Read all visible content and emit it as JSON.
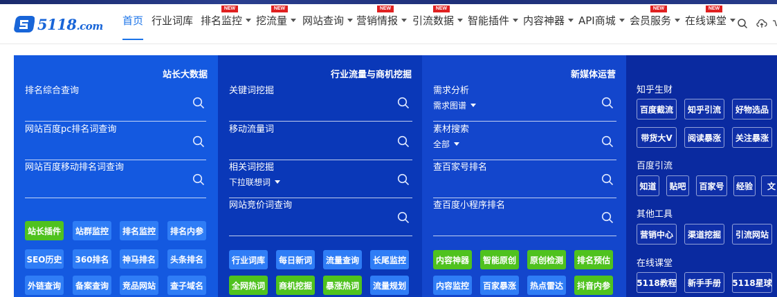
{
  "logo": {
    "text": "5118",
    "suffix": ".com"
  },
  "nav": {
    "items": [
      {
        "label": "首页",
        "active": true,
        "caret": false,
        "new": false
      },
      {
        "label": "行业词库",
        "caret": false,
        "new": false
      },
      {
        "label": "排名监控",
        "caret": true,
        "new": true
      },
      {
        "label": "挖流量",
        "caret": true,
        "new": true
      },
      {
        "label": "网站查询",
        "caret": true,
        "new": false
      },
      {
        "label": "营销情报",
        "caret": true,
        "new": true
      },
      {
        "label": "引流数据",
        "caret": true,
        "new": true
      },
      {
        "label": "智能插件",
        "caret": true,
        "new": false
      },
      {
        "label": "内容神器",
        "caret": true,
        "new": false
      },
      {
        "label": "API商城",
        "caret": true,
        "new": false
      },
      {
        "label": "会员服务",
        "caret": true,
        "new": true
      },
      {
        "label": "在线课堂",
        "caret": true,
        "new": true
      }
    ],
    "new_badge": "NEW",
    "icons": [
      "search-icon",
      "cloud-upload-icon"
    ]
  },
  "colors": {
    "nav_active": "#1a73e8",
    "panel_a": "#1459e0",
    "panel_b": "#0a38b8",
    "panel_c": "#1346cc",
    "panel_d": "#0a2aa0",
    "green": "#4fc21e",
    "blue_btn": "#2f7df6"
  },
  "columns": [
    {
      "title": "站长大数据",
      "fields": [
        {
          "label": "排名综合查询",
          "sub": ""
        },
        {
          "label": "网站百度pc排名词查询",
          "sub": ""
        },
        {
          "label": "网站百度移动排名词查询",
          "sub": ""
        }
      ],
      "buttons": [
        {
          "label": "站长插件",
          "color": "green"
        },
        {
          "label": "站群监控",
          "color": "blue"
        },
        {
          "label": "排名监控",
          "color": "blue"
        },
        {
          "label": "排名内参",
          "color": "blue"
        },
        {
          "label": "SEO历史",
          "color": "blue"
        },
        {
          "label": "360排名",
          "color": "blue"
        },
        {
          "label": "神马排名",
          "color": "blue"
        },
        {
          "label": "头条排名",
          "color": "blue"
        },
        {
          "label": "外链查询",
          "color": "blue"
        },
        {
          "label": "备案查询",
          "color": "blue"
        },
        {
          "label": "竞品网站",
          "color": "blue"
        },
        {
          "label": "查子域名",
          "color": "blue"
        }
      ]
    },
    {
      "title": "行业流量与商机挖掘",
      "fields": [
        {
          "label": "关键词挖掘",
          "sub": ""
        },
        {
          "label": "移动流量词",
          "sub": ""
        },
        {
          "label": "相关词挖掘",
          "sub": "下拉联想词"
        },
        {
          "label": "网站竞价词查询",
          "sub": ""
        }
      ],
      "buttons": [
        {
          "label": "行业词库",
          "color": "blue"
        },
        {
          "label": "每日新词",
          "color": "blue"
        },
        {
          "label": "流量查询",
          "color": "blue"
        },
        {
          "label": "长尾监控",
          "color": "blue"
        },
        {
          "label": "全网热词",
          "color": "green"
        },
        {
          "label": "商机挖掘",
          "color": "green"
        },
        {
          "label": "暴涨热词",
          "color": "green"
        },
        {
          "label": "流量规划",
          "color": "blue"
        }
      ]
    },
    {
      "title": "新媒体运营",
      "fields": [
        {
          "label": "需求分析",
          "sub": "需求图谱"
        },
        {
          "label": "素材搜索",
          "sub": "全部"
        },
        {
          "label": "查百家号排名",
          "sub": ""
        },
        {
          "label": "查百度小程序排名",
          "sub": ""
        }
      ],
      "buttons": [
        {
          "label": "内容神器",
          "color": "green"
        },
        {
          "label": "智能原创",
          "color": "green"
        },
        {
          "label": "原创检测",
          "color": "green"
        },
        {
          "label": "排名预估",
          "color": "green"
        },
        {
          "label": "内容监控",
          "color": "blue"
        },
        {
          "label": "百家暴涨",
          "color": "blue"
        },
        {
          "label": "热点雷达",
          "color": "blue"
        },
        {
          "label": "抖音内参",
          "color": "green"
        }
      ]
    }
  ],
  "right_panel": {
    "groups": [
      {
        "heading": "知乎生财",
        "buttons": [
          "百度截流",
          "知乎引流",
          "好物选品",
          "带货大V",
          "阅读暴涨",
          "关注暴涨"
        ]
      },
      {
        "heading": "百度引流",
        "buttons": [
          "知道",
          "贴吧",
          "百家号",
          "经验",
          "文"
        ]
      },
      {
        "heading": "其他工具",
        "buttons": [
          "营销中心",
          "渠道挖掘",
          "引流网站"
        ]
      },
      {
        "heading": "在线课堂",
        "buttons": [
          "5118教程",
          "新手手册",
          "5118星球"
        ]
      }
    ]
  }
}
